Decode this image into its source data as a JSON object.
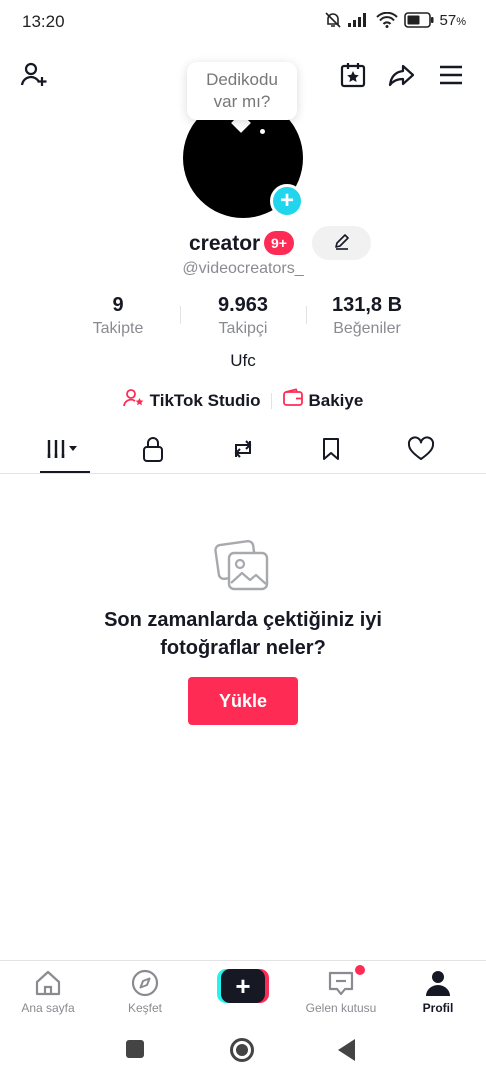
{
  "status_bar": {
    "time": "13:20",
    "battery": "57",
    "battery_unit": "%",
    "icons": [
      "bell-muted-icon",
      "signal-icon",
      "wifi-icon",
      "battery-icon"
    ]
  },
  "header": {
    "icons": [
      "add-friend-icon",
      "calendar-star-icon",
      "share-icon",
      "menu-icon"
    ]
  },
  "tooltip": {
    "line1": "Dedikodu",
    "line2": "var mı?"
  },
  "profile": {
    "username": "creator",
    "notification_badge": "9+",
    "handle": "@videocreators_",
    "bio": "Ufc",
    "stats": [
      {
        "value": "9",
        "label": "Takipte"
      },
      {
        "value": "9.963",
        "label": "Takipçi"
      },
      {
        "value": "131,8 B",
        "label": "Beğeniler"
      }
    ],
    "links": [
      {
        "label": "TikTok Studio",
        "icon": "creator-studio-icon"
      },
      {
        "label": "Bakiye",
        "icon": "wallet-icon"
      }
    ]
  },
  "tabs": [
    {
      "icon": "videos-grid-icon",
      "active": true
    },
    {
      "icon": "lock-icon",
      "active": false
    },
    {
      "icon": "repost-icon",
      "active": false
    },
    {
      "icon": "bookmark-icon",
      "active": false
    },
    {
      "icon": "heart-icon",
      "active": false
    }
  ],
  "empty_state": {
    "icon": "photos-icon",
    "line1": "Son zamanlarda çektiğiniz iyi",
    "line2": "fotoğraflar neler?",
    "button_label": "Yükle"
  },
  "bottom_nav": [
    {
      "label": "Ana sayfa",
      "icon": "home-icon"
    },
    {
      "label": "Keşfet",
      "icon": "compass-icon"
    },
    {
      "label": "",
      "icon": "create-plus-icon"
    },
    {
      "label": "Gelen kutusu",
      "icon": "inbox-icon"
    },
    {
      "label": "Profil",
      "icon": "profile-icon",
      "active": true
    }
  ],
  "colors": {
    "accent": "#fe2c55",
    "cyan": "#25f4ee",
    "text": "#161823",
    "muted": "#8a8b91"
  }
}
